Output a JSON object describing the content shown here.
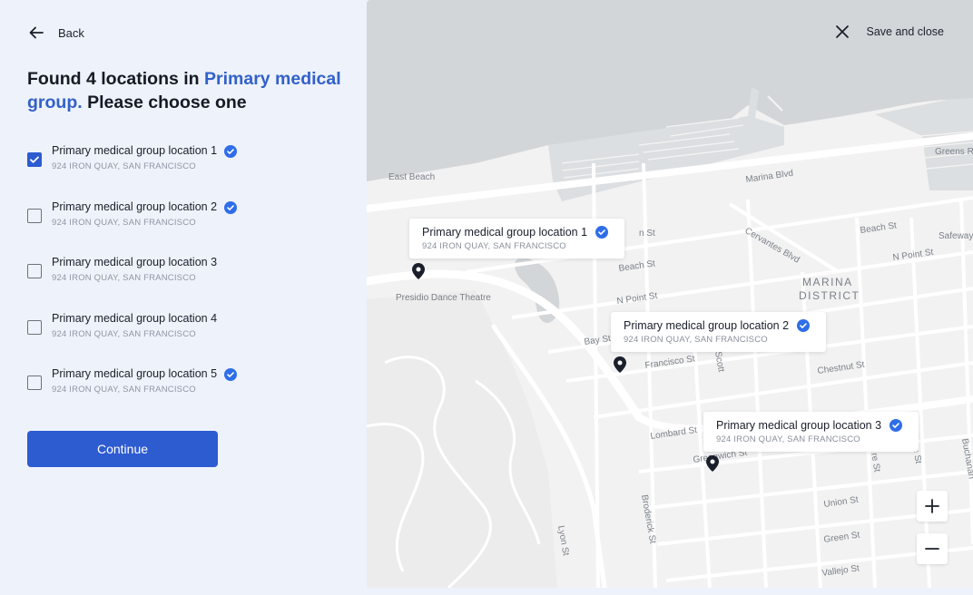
{
  "nav": {
    "back_label": "Back"
  },
  "heading": {
    "prefix": "Found 4 locations in ",
    "group": "Primary medical group.",
    "suffix": " Please choose one"
  },
  "locations": [
    {
      "name": "Primary medical group location 1",
      "address": "924 IRON QUAY, SAN FRANCISCO",
      "checked": true,
      "verified": true
    },
    {
      "name": "Primary medical group location 2",
      "address": "924 IRON QUAY, SAN FRANCISCO",
      "checked": false,
      "verified": true
    },
    {
      "name": "Primary medical group location 3",
      "address": "924 IRON QUAY, SAN FRANCISCO",
      "checked": false,
      "verified": false
    },
    {
      "name": "Primary medical group location 4",
      "address": "924 IRON QUAY, SAN FRANCISCO",
      "checked": false,
      "verified": false
    },
    {
      "name": "Primary medical group location 5",
      "address": "924 IRON QUAY, SAN FRANCISCO",
      "checked": false,
      "verified": true
    }
  ],
  "continue_label": "Continue",
  "map": {
    "save_close_label": "Save and close",
    "cards": [
      {
        "name": "Primary medical group location 1",
        "address": "924 IRON QUAY, SAN FRANCISCO"
      },
      {
        "name": "Primary medical group location 2",
        "address": "924 IRON QUAY, SAN FRANCISCO"
      },
      {
        "name": "Primary medical group location 3",
        "address": "924 IRON QUAY, SAN FRANCISCO"
      }
    ],
    "labels": {
      "east_beach": "East Beach",
      "marina_blvd": "Marina Blvd",
      "greens_re": "Greens Re",
      "beach_st_1": "Beach St",
      "beach_st_2": "Beach St",
      "cervantes": "Cervantes Blvd",
      "safeway": "Safeway",
      "n_point_1": "N Point St",
      "n_point_2": "N Point St",
      "marina": "MARINA",
      "district": "DISTRICT",
      "presidio": "Presidio Dance Theatre",
      "bay_st": "Bay St",
      "francisco_st": "Francisco St",
      "chestnut_st": "Chestnut St",
      "lombard_st": "Lombard St",
      "greenwich": "Greenwich St",
      "union_st": "Union St",
      "green_st": "Green St",
      "vallejo_st": "Vallejo St",
      "broderick": "Broderick St",
      "lyon": "Lyon St",
      "buchanan": "Buchanan",
      "n_st": "n St",
      "scott": "Scott",
      "fillmore": "re St",
      "webster": "e St"
    }
  },
  "colors": {
    "accent": "#2d5bd0",
    "heading_accent": "#3261c9",
    "verified": "#2f6ee8",
    "water": "#d3d6d9",
    "land": "#f2f2f2"
  }
}
